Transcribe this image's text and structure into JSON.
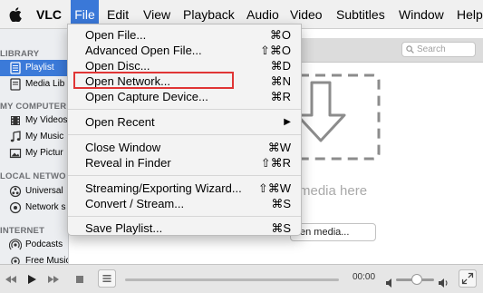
{
  "menubar": {
    "apple": "",
    "items": [
      "VLC",
      "File",
      "Edit",
      "View",
      "Playback",
      "Audio",
      "Video",
      "Subtitles",
      "Window",
      "Help"
    ]
  },
  "file_menu": {
    "items": [
      {
        "label": "Open File...",
        "shortcut": "⌘O"
      },
      {
        "label": "Advanced Open File...",
        "shortcut": "⇧⌘O"
      },
      {
        "label": "Open Disc...",
        "shortcut": "⌘D"
      },
      {
        "label": "Open Network...",
        "shortcut": "⌘N"
      },
      {
        "label": "Open Capture Device...",
        "shortcut": "⌘R"
      },
      {
        "label": "Open Recent",
        "shortcut": "▶"
      },
      {
        "label": "Close Window",
        "shortcut": "⌘W"
      },
      {
        "label": "Reveal in Finder",
        "shortcut": "⇧⌘R"
      },
      {
        "label": "Streaming/Exporting Wizard...",
        "shortcut": "⇧⌘W"
      },
      {
        "label": "Convert / Stream...",
        "shortcut": "⌘S"
      },
      {
        "label": "Save Playlist...",
        "shortcut": "⌘S"
      }
    ],
    "highlighted_item": "Open Network..."
  },
  "sidebar": {
    "sections": [
      "LIBRARY",
      "MY COMPUTER",
      "LOCAL NETWO",
      "INTERNET"
    ],
    "items": [
      {
        "label": "Playlist",
        "icon": "playlist-icon",
        "selected": true
      },
      {
        "label": "Media Lib",
        "icon": "media-library-icon"
      },
      {
        "label": "My Videos",
        "icon": "film-icon"
      },
      {
        "label": "My Music",
        "icon": "music-note-icon"
      },
      {
        "label": "My Pictur",
        "icon": "picture-icon"
      },
      {
        "label": "Universal",
        "icon": "upnp-icon"
      },
      {
        "label": "Network s",
        "icon": "network-icon"
      },
      {
        "label": "Podcasts",
        "icon": "podcast-icon"
      },
      {
        "label": "Free Music Charts",
        "icon": "podcast-icon"
      }
    ]
  },
  "search": {
    "placeholder": "Search"
  },
  "main": {
    "drop_text": "media here",
    "open_media_button": "en media..."
  },
  "controls": {
    "time": "00:00",
    "volume_level": 0.55
  },
  "colors": {
    "accent": "#3a78d8",
    "highlight_box": "#e03535"
  }
}
